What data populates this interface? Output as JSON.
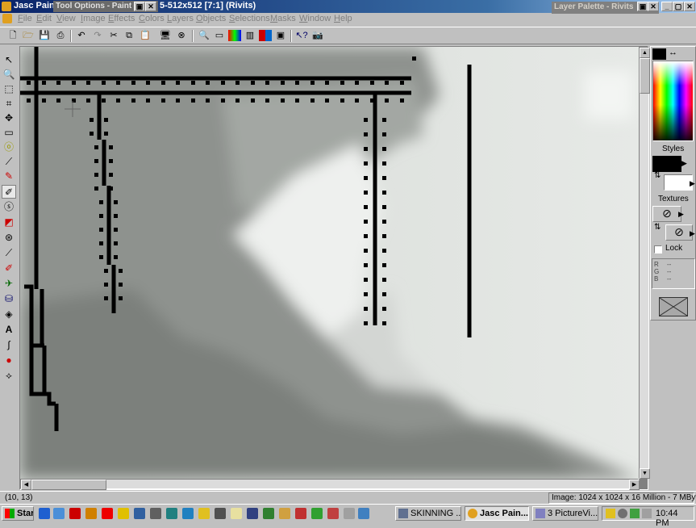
{
  "app": {
    "title_fragment": "Jasc Pain",
    "doc_title_fragment": "5-512x512 [7:1] (Rivits)",
    "tool_options_title": "Tool Options - Paint",
    "layer_palette_title": "Layer Palette - Rivits"
  },
  "menu": [
    "File",
    "Edit",
    "View",
    "Image",
    "Effects",
    "Colors",
    "Layers",
    "Objects",
    "Selections",
    "Masks",
    "Window",
    "Help"
  ],
  "toolbar_icons": [
    "new-icon",
    "open-icon",
    "save-icon",
    "print-icon",
    "undo-icon",
    "redo-icon",
    "cut-icon",
    "copy-icon",
    "paste-icon",
    "browse-icon",
    "scan-icon",
    "zoom-icon",
    "toolbar-toggle-icon",
    "color-icon",
    "histogram-icon",
    "palette-icon",
    "layers-icon",
    "help-icon",
    "camera-icon"
  ],
  "tools": [
    "arrow-tool",
    "zoom-tool",
    "deformation-tool",
    "crop-tool",
    "mover-tool",
    "selection-tool",
    "freehand-selection-tool",
    "dropper-tool",
    "paint-brush-tool",
    "clone-brush-tool",
    "color-replacer-tool",
    "retouch-tool",
    "scratch-remover-tool",
    "eraser-tool",
    "picture-tube-tool",
    "airbrush-tool",
    "flood-fill-tool",
    "text-tool",
    "draw-tool",
    "preset-shapes-tool",
    "object-selector-tool"
  ],
  "palette": {
    "styles_label": "Styles",
    "textures_label": "Textures",
    "lock_label": "Lock",
    "rgb": [
      {
        "k": "R",
        "v": "--"
      },
      {
        "k": "G",
        "v": "--"
      },
      {
        "k": "B",
        "v": "--"
      }
    ],
    "colors": {
      "foreground": "#000000",
      "background": "#ffffff"
    }
  },
  "status": {
    "coords": "(10, 13)",
    "image_info": "Image:  1024 x 1024 x 16 Million - 7 MBytes"
  },
  "taskbar": {
    "start": "Start",
    "tasks": [
      {
        "label": "SKINNING ...",
        "active": false
      },
      {
        "label": "Jasc Pain...",
        "active": true
      },
      {
        "label": "3 PictureVi...",
        "active": false
      }
    ],
    "clock": "10:44 PM"
  },
  "colors": {
    "titlebar": "#0a246a",
    "face": "#c0c0c0",
    "canvas_dark": "#8a8e8a",
    "canvas_light": "#dfe3df"
  }
}
